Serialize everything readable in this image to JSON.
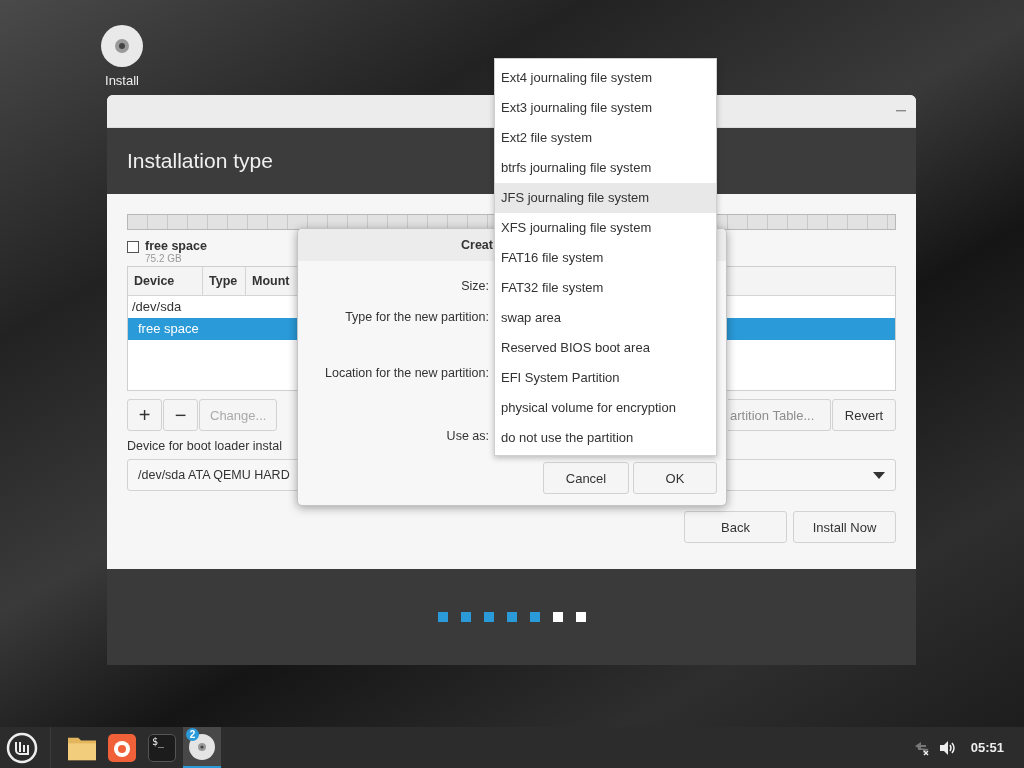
{
  "desktop_icons": [
    {
      "label": "Install"
    }
  ],
  "installer": {
    "title": "Installation type",
    "legend": [
      {
        "label": "free space",
        "size": "75.2 GB"
      }
    ],
    "table": {
      "columns": [
        "Device",
        "Type",
        "Mount"
      ],
      "rows": [
        {
          "device": "/dev/sda",
          "selected": false,
          "children": [
            {
              "device": "free space",
              "selected": true
            }
          ]
        }
      ]
    },
    "partition_buttons": [
      {
        "label": "+",
        "disabled": false,
        "kind": "square"
      },
      {
        "label": "−",
        "disabled": false,
        "kind": "square"
      },
      {
        "label": "Change...",
        "disabled": true,
        "kind": "wide"
      },
      {
        "label": "artition Table...",
        "disabled": true,
        "kind": "partial"
      },
      {
        "label": "Revert",
        "disabled": false,
        "kind": "wide"
      }
    ],
    "boot_loader": {
      "label": "Device for boot loader instal",
      "value": "/dev/sda ATA QEMU HARD"
    },
    "nav_buttons": [
      "Back",
      "Install Now"
    ],
    "steps": [
      {
        "done": true
      },
      {
        "done": true
      },
      {
        "done": true
      },
      {
        "done": true
      },
      {
        "done": true
      },
      {
        "done": false
      },
      {
        "done": false
      }
    ]
  },
  "dialog": {
    "title": "Creat",
    "labels": [
      "Size:",
      "Type for the new partition:",
      "Location for the new partition:",
      "Use as:"
    ],
    "buttons": [
      "Cancel",
      "OK"
    ]
  },
  "menu": {
    "items": [
      {
        "label": "Ext4 journaling file system",
        "selected": false
      },
      {
        "label": "Ext3 journaling file system",
        "selected": false
      },
      {
        "label": "Ext2 file system",
        "selected": false
      },
      {
        "label": "btrfs journaling file system",
        "selected": false
      },
      {
        "label": "JFS journaling file system",
        "selected": true
      },
      {
        "label": "XFS journaling file system",
        "selected": false
      },
      {
        "label": "FAT16 file system",
        "selected": false
      },
      {
        "label": "FAT32 file system",
        "selected": false
      },
      {
        "label": "swap area",
        "selected": false
      },
      {
        "label": "Reserved BIOS boot area",
        "selected": false
      },
      {
        "label": "EFI System Partition",
        "selected": false
      },
      {
        "label": "physical volume for encryption",
        "selected": false
      },
      {
        "label": "do not use the partition",
        "selected": false
      }
    ]
  },
  "taskbar": {
    "apps": [
      {
        "kind": "files",
        "active": false
      },
      {
        "kind": "browser",
        "active": false
      },
      {
        "kind": "terminal",
        "active": false,
        "label": "$_"
      },
      {
        "kind": "installer",
        "active": true,
        "badge": "2"
      }
    ],
    "clock": "05:51"
  }
}
